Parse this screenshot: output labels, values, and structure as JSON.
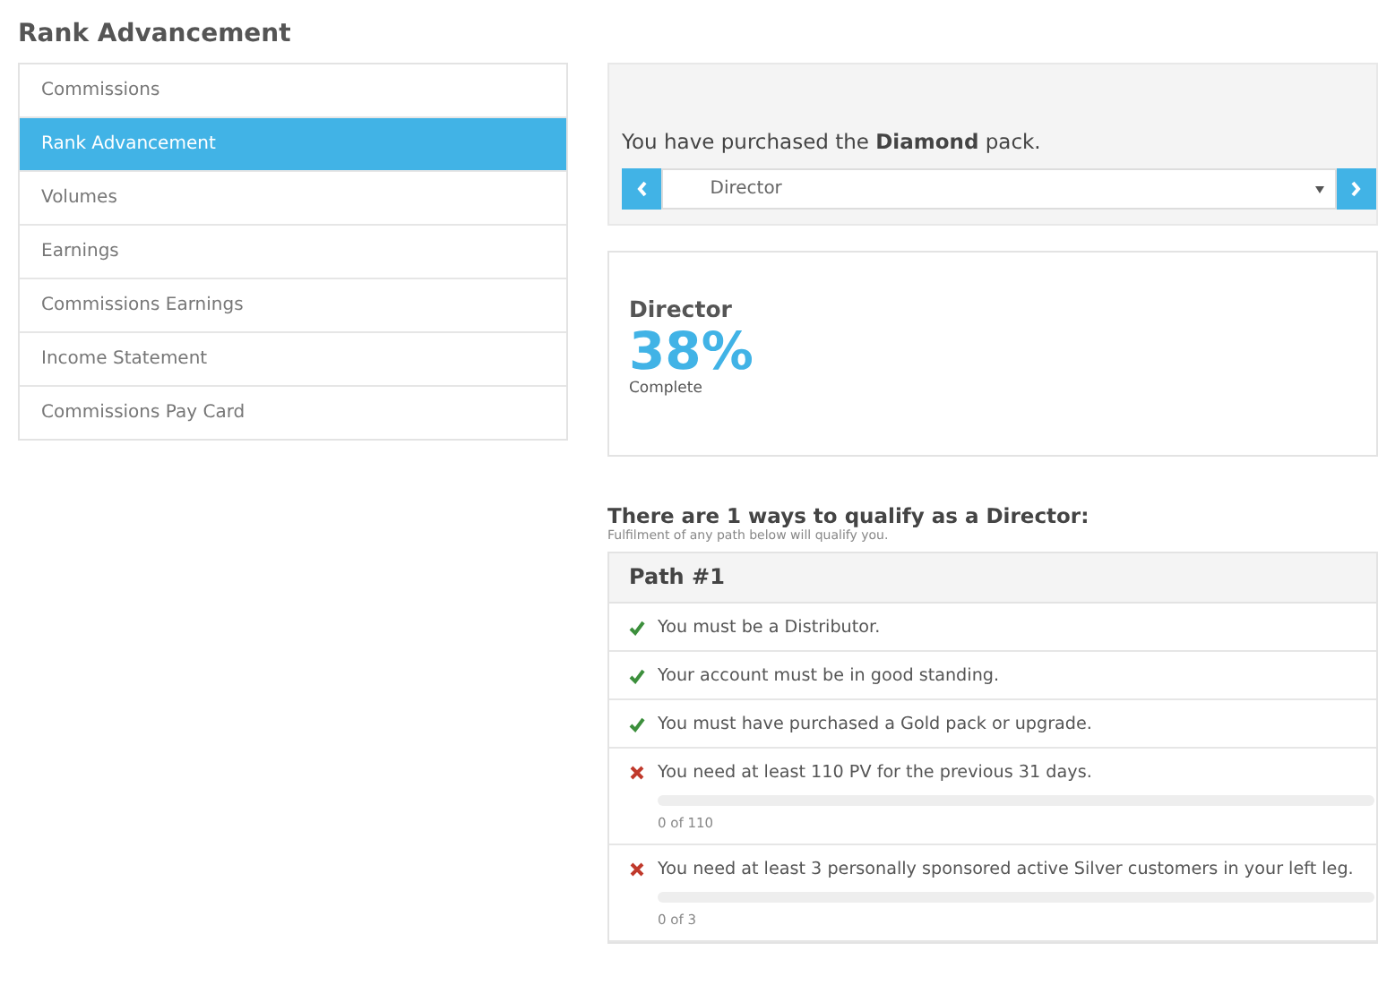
{
  "page_title": "Rank Advancement",
  "sidebar": {
    "items": [
      {
        "label": "Commissions",
        "selected": false
      },
      {
        "label": "Rank Advancement",
        "selected": true
      },
      {
        "label": "Volumes",
        "selected": false
      },
      {
        "label": "Earnings",
        "selected": false
      },
      {
        "label": "Commissions Earnings",
        "selected": false
      },
      {
        "label": "Income Statement",
        "selected": false
      },
      {
        "label": "Commissions Pay Card",
        "selected": false
      }
    ]
  },
  "pack_panel": {
    "message": "You have purchased the **Diamond** pack.",
    "rank_select": {
      "value": "Director"
    }
  },
  "rank_card": {
    "rank": "Director",
    "percent": "38%",
    "caption": "Complete"
  },
  "qualify": {
    "heading": "There are 1 ways to qualify as a Director:",
    "subheading": "Fulfilment of any path below will qualify you.",
    "paths": [
      {
        "title": "Path #1",
        "requirements": [
          {
            "kind": "plain",
            "met": true,
            "text": "You must be a Distributor."
          },
          {
            "kind": "plain",
            "met": true,
            "text": "Your account must be in good standing."
          },
          {
            "kind": "plain",
            "met": true,
            "text": "You must have purchased a Gold pack or upgrade."
          },
          {
            "kind": "progress",
            "met": false,
            "text": "You need at least 110 PV for the previous 31 days.",
            "level": 0,
            "reading": "0 of 110"
          },
          {
            "kind": "progress",
            "met": false,
            "text": "You need at least 3 personally sponsored active Silver customers in your left leg.",
            "level": 0,
            "reading": "0 of 3"
          }
        ]
      }
    ]
  }
}
